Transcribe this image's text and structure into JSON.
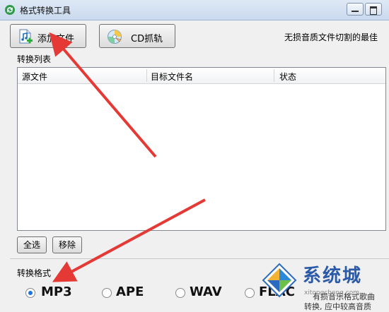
{
  "window": {
    "title": "格式转换工具"
  },
  "toolbar": {
    "add_file_label": "添加文件",
    "cd_label": "CD抓轨"
  },
  "slogan": "无损音质文件切割的最佳",
  "list": {
    "section_label": "转换列表",
    "columns": [
      "源文件",
      "目标文件名",
      "状态"
    ]
  },
  "actions": {
    "select_all_label": "全选",
    "remove_label": "移除"
  },
  "format": {
    "section_label": "转换格式",
    "options": [
      {
        "label": "MP3",
        "checked": true
      },
      {
        "label": "APE",
        "checked": false
      },
      {
        "label": "WAV",
        "checked": false
      },
      {
        "label": "FLAC",
        "checked": false
      }
    ],
    "description_line1": "有损音乐格式歌曲",
    "description_line2": "转换, 应中较高音质"
  },
  "watermark": {
    "text": "系统城",
    "sub": "xitongcheng.com"
  },
  "colors": {
    "accent": "#1a73d9",
    "annotation_arrow": "#e53935"
  },
  "icons": {
    "title": "app-convert-icon",
    "add_file": "music-file-add-icon",
    "cd": "cd-disc-icon"
  }
}
